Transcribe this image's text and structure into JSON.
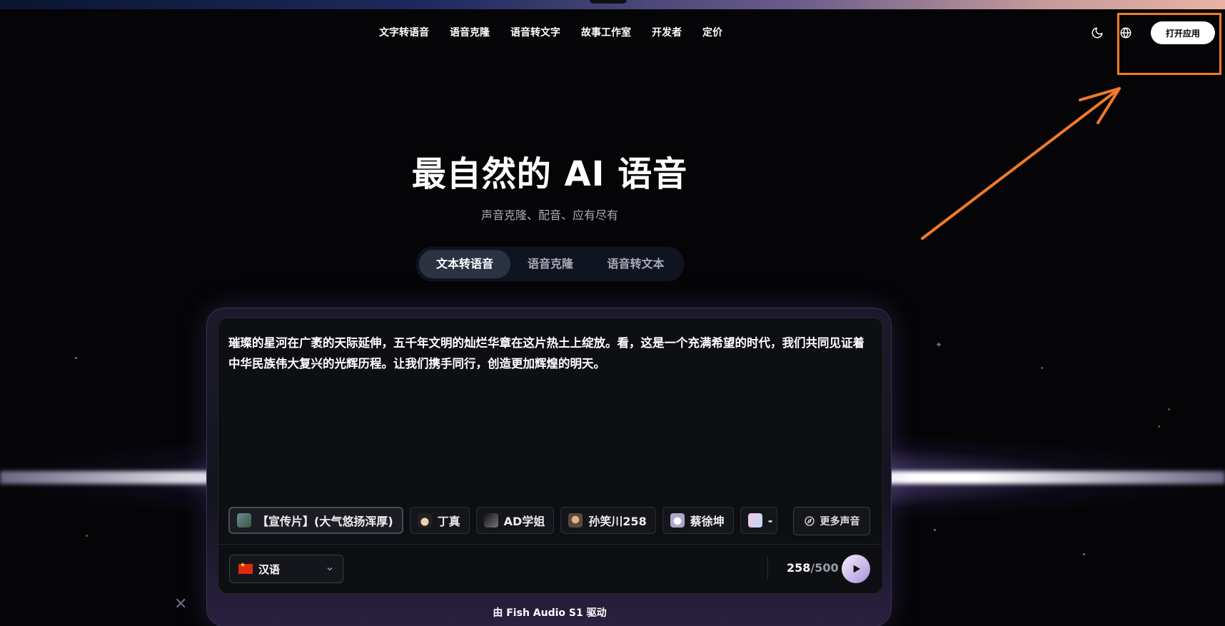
{
  "nav": {
    "items": [
      "文字转语音",
      "语音克隆",
      "语音转文字",
      "故事工作室",
      "开发者",
      "定价"
    ],
    "open_app": "打开应用"
  },
  "icons": {
    "theme": "moon-icon",
    "language": "globe-icon",
    "more_voices": "compass-icon",
    "dropdown": "chevron-down-icon",
    "play": "play-icon"
  },
  "hero": {
    "title": "最自然的 AI 语音",
    "subtitle": "声音克隆、配音、应有尽有"
  },
  "tabs": [
    {
      "label": "文本转语音",
      "active": true
    },
    {
      "label": "语音克隆",
      "active": false
    },
    {
      "label": "语音转文本",
      "active": false
    }
  ],
  "editor": {
    "text": "璀璨的星河在广袤的天际延伸，五千年文明的灿烂华章在这片热土上绽放。看，这是一个充满希望的时代，我们共同见证着中华民族伟大复兴的光辉历程。让我们携手同行，创造更加辉煌的明天。"
  },
  "voices": [
    {
      "name": "【宣传片】(大气悠扬浑厚)",
      "selected": true,
      "color": "#5a7a6a"
    },
    {
      "name": "丁真",
      "selected": false,
      "color": "#c9a27a"
    },
    {
      "name": "AD学姐",
      "selected": false,
      "color": "#333333"
    },
    {
      "name": "孙笑川258",
      "selected": false,
      "color": "#b88a6a"
    },
    {
      "name": "蔡徐坤",
      "selected": false,
      "color": "#d8c8d8"
    },
    {
      "name": "-",
      "selected": false,
      "color": "#e8a8c8"
    }
  ],
  "more_voices": "更多声音",
  "language": {
    "selected": "汉语"
  },
  "counter": {
    "current": "258",
    "max": "/500"
  },
  "footer": {
    "powered_by": "由 Fish Audio S1 驱动"
  },
  "colors": {
    "annotation": "#f07a2a",
    "accent_bg": "#2b3342"
  }
}
